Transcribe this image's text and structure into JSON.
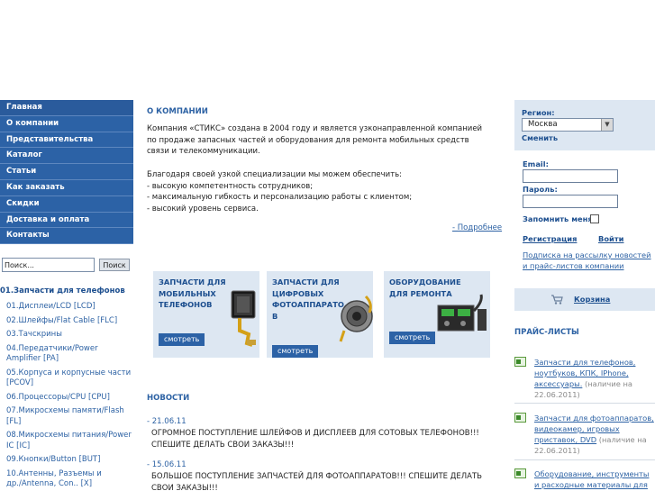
{
  "colors": {
    "nav_bg": "#2c62a6",
    "accent": "#2d62a4",
    "panel_bg": "#dde7f2"
  },
  "nav": {
    "items": [
      "Главная",
      "О компании",
      "Представительства",
      "Каталог",
      "Статьи",
      "Как заказать",
      "Скидки",
      "Доставка и оплата",
      "Контакты"
    ]
  },
  "search": {
    "value": "Поиск...",
    "button": "Поиск"
  },
  "catalog": {
    "title": "01.Запчасти для телефонов",
    "items": [
      "01.Дисплеи/LCD [LCD]",
      "02.Шлейфы/Flat Cable [FLC]",
      "03.Тачскрины",
      "04.Передатчики/Power Amplifier [PA]",
      "05.Корпуса и корпусные части [PCOV]",
      "06.Процессоры/CPU [CPU]",
      "07.Микросхемы памяти/Flash [FL]",
      "08.Микросхемы питания/Power IC [IC]",
      "09.Кнопки/Button [BUT]",
      "10.Антенны, Разъемы и др./Antenna, Con.. [X]"
    ]
  },
  "about": {
    "title": "О КОМПАНИИ",
    "p1": "Компания «СТИКС» создана в 2004 году и является узконаправленной компанией по продаже запасных частей и оборудования для ремонта мобильных средств связи и телекоммуникации.",
    "p2": "Благодаря своей узкой специализации мы можем обеспечить:",
    "bullets": [
      "- высокую компетентность сотрудников;",
      "- максимальную гибкость и персонализацию работы с клиентом;",
      "- высокий уровень сервиса."
    ],
    "more": "- Подробнее"
  },
  "banners": [
    {
      "title": "ЗАПЧАСТИ ДЛЯ МОБИЛЬНЫХ ТЕЛЕФОНОВ",
      "button": "смотреть",
      "icon": "phone-display-part-icon"
    },
    {
      "title": "ЗАПЧАСТИ ДЛЯ ЦИФРОВЫХ ФОТОАППАРАТО В",
      "button": "смотреть",
      "icon": "camera-lens-part-icon"
    },
    {
      "title": "ОБОРУДОВАНИЕ ДЛЯ РЕМОНТА",
      "button": "смотреть",
      "icon": "soldering-station-icon"
    }
  ],
  "news": {
    "title": "НОВОСТИ",
    "items": [
      {
        "date": "- 21.06.11",
        "text": "ОГРОМНОЕ ПОСТУПЛЕНИЕ ШЛЕЙФОВ И ДИСПЛЕЕВ ДЛЯ СОТОВЫХ ТЕЛЕФОНОВ!!! СПЕШИТЕ ДЕЛАТЬ СВОИ ЗАКАЗЫ!!!"
      },
      {
        "date": "- 15.06.11",
        "text": "БОЛЬШОЕ ПОСТУПЛЕНИЕ ЗАПЧАСТЕЙ ДЛЯ ФОТОАППАРАТОВ!!! СПЕШИТЕ ДЕЛАТЬ СВОИ ЗАКАЗЫ!!!"
      }
    ]
  },
  "region": {
    "label": "Регион:",
    "value": "Москва",
    "change": "Сменить"
  },
  "login": {
    "email_label": "Email:",
    "password_label": "Пароль:",
    "remember_label": "Запомнить меня:",
    "register": "Регистрация",
    "login": "Войти",
    "subscribe": "Подписка на рассылку новостей и прайс-листов компании"
  },
  "cart": {
    "label": "Корзина"
  },
  "price_lists": {
    "title": "ПРАЙС-ЛИСТЫ",
    "items": [
      {
        "link": "Запчасти для телефонов, ноутбуков, КПК, IPhone, аксессуары.",
        "note": " (наличие на 22.06.2011)"
      },
      {
        "link": "Запчасти для фотоаппаратов, видеокамер, игровых приставок, DVD",
        "note": " (наличие на 22.06.2011)"
      },
      {
        "link": "Оборудование, инструменты и расходные материалы для",
        "note": ""
      }
    ]
  }
}
